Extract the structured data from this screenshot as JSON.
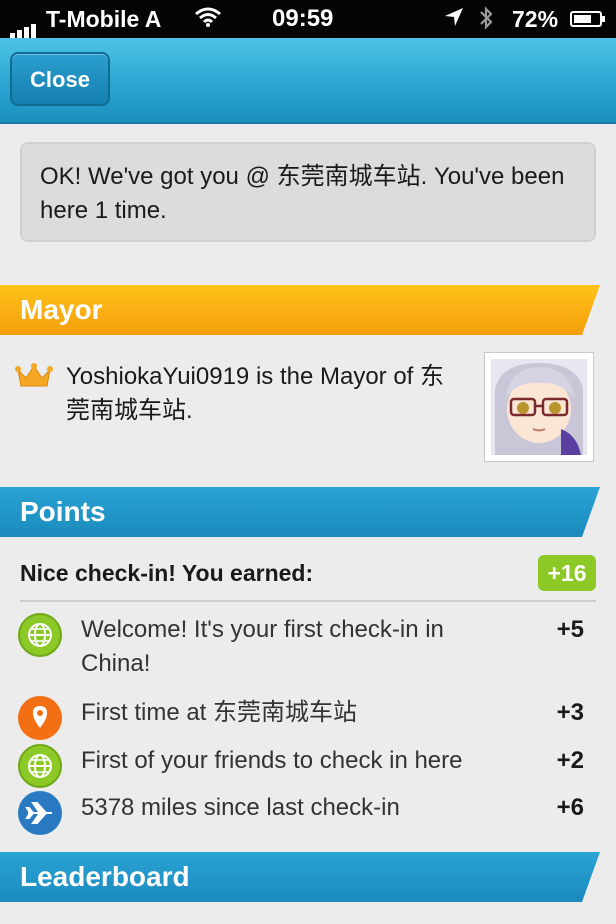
{
  "status_bar": {
    "carrier": "T-Mobile A",
    "time": "09:59",
    "battery": "72%",
    "battery_level": 0.72
  },
  "nav": {
    "close_label": "Close"
  },
  "message": {
    "text": "OK! We've got you @ 东莞南城车站. You've been here 1 time."
  },
  "mayor": {
    "title": "Mayor",
    "text": "YoshiokaYui0919 is the Mayor of 东莞南城车站."
  },
  "points": {
    "title": "Points",
    "earned_label": "Nice check-in! You earned:",
    "total": "+16",
    "items": [
      {
        "icon": "globe-icon",
        "text": "Welcome! It's your first check-in in China!",
        "points": "+5"
      },
      {
        "icon": "location-pin-icon",
        "text": "First time at 东莞南城车站",
        "points": "+3"
      },
      {
        "icon": "globe-icon",
        "text": "First of your friends to check in here",
        "points": "+2"
      },
      {
        "icon": "airplane-icon",
        "text": "5378 miles since last check-in",
        "points": "+6"
      }
    ]
  },
  "leaderboard": {
    "title": "Leaderboard"
  },
  "colors": {
    "accent_blue": "#1b8abd",
    "mayor_orange": "#f49e0b",
    "points_green": "#8cc926"
  }
}
